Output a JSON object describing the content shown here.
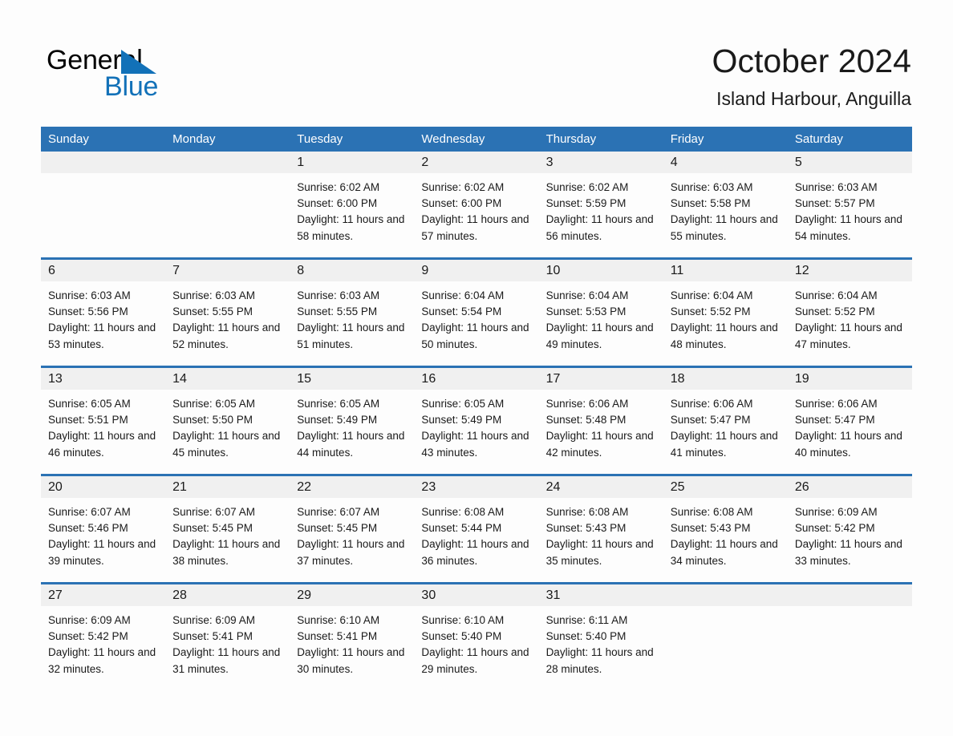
{
  "logo": {
    "word_one": "General",
    "word_two": "Blue",
    "triangle_icon": "triangle-icon",
    "primary_color": "#1271b8"
  },
  "header": {
    "title": "October 2024",
    "location": "Island Harbour, Anguilla"
  },
  "theme": {
    "header_blue": "#2b72b4",
    "day_band_gray": "#f0f0f0",
    "page_background": "#fdfdfd",
    "text_color": "#1a1a1a"
  },
  "calendar": {
    "weekdays": [
      "Sunday",
      "Monday",
      "Tuesday",
      "Wednesday",
      "Thursday",
      "Friday",
      "Saturday"
    ],
    "weeks": [
      [
        {
          "day": "",
          "empty": true
        },
        {
          "day": "",
          "empty": true
        },
        {
          "day": "1",
          "sunrise": "Sunrise: 6:02 AM",
          "sunset": "Sunset: 6:00 PM",
          "daylight": "Daylight: 11 hours and 58 minutes."
        },
        {
          "day": "2",
          "sunrise": "Sunrise: 6:02 AM",
          "sunset": "Sunset: 6:00 PM",
          "daylight": "Daylight: 11 hours and 57 minutes."
        },
        {
          "day": "3",
          "sunrise": "Sunrise: 6:02 AM",
          "sunset": "Sunset: 5:59 PM",
          "daylight": "Daylight: 11 hours and 56 minutes."
        },
        {
          "day": "4",
          "sunrise": "Sunrise: 6:03 AM",
          "sunset": "Sunset: 5:58 PM",
          "daylight": "Daylight: 11 hours and 55 minutes."
        },
        {
          "day": "5",
          "sunrise": "Sunrise: 6:03 AM",
          "sunset": "Sunset: 5:57 PM",
          "daylight": "Daylight: 11 hours and 54 minutes."
        }
      ],
      [
        {
          "day": "6",
          "sunrise": "Sunrise: 6:03 AM",
          "sunset": "Sunset: 5:56 PM",
          "daylight": "Daylight: 11 hours and 53 minutes."
        },
        {
          "day": "7",
          "sunrise": "Sunrise: 6:03 AM",
          "sunset": "Sunset: 5:55 PM",
          "daylight": "Daylight: 11 hours and 52 minutes."
        },
        {
          "day": "8",
          "sunrise": "Sunrise: 6:03 AM",
          "sunset": "Sunset: 5:55 PM",
          "daylight": "Daylight: 11 hours and 51 minutes."
        },
        {
          "day": "9",
          "sunrise": "Sunrise: 6:04 AM",
          "sunset": "Sunset: 5:54 PM",
          "daylight": "Daylight: 11 hours and 50 minutes."
        },
        {
          "day": "10",
          "sunrise": "Sunrise: 6:04 AM",
          "sunset": "Sunset: 5:53 PM",
          "daylight": "Daylight: 11 hours and 49 minutes."
        },
        {
          "day": "11",
          "sunrise": "Sunrise: 6:04 AM",
          "sunset": "Sunset: 5:52 PM",
          "daylight": "Daylight: 11 hours and 48 minutes."
        },
        {
          "day": "12",
          "sunrise": "Sunrise: 6:04 AM",
          "sunset": "Sunset: 5:52 PM",
          "daylight": "Daylight: 11 hours and 47 minutes."
        }
      ],
      [
        {
          "day": "13",
          "sunrise": "Sunrise: 6:05 AM",
          "sunset": "Sunset: 5:51 PM",
          "daylight": "Daylight: 11 hours and 46 minutes."
        },
        {
          "day": "14",
          "sunrise": "Sunrise: 6:05 AM",
          "sunset": "Sunset: 5:50 PM",
          "daylight": "Daylight: 11 hours and 45 minutes."
        },
        {
          "day": "15",
          "sunrise": "Sunrise: 6:05 AM",
          "sunset": "Sunset: 5:49 PM",
          "daylight": "Daylight: 11 hours and 44 minutes."
        },
        {
          "day": "16",
          "sunrise": "Sunrise: 6:05 AM",
          "sunset": "Sunset: 5:49 PM",
          "daylight": "Daylight: 11 hours and 43 minutes."
        },
        {
          "day": "17",
          "sunrise": "Sunrise: 6:06 AM",
          "sunset": "Sunset: 5:48 PM",
          "daylight": "Daylight: 11 hours and 42 minutes."
        },
        {
          "day": "18",
          "sunrise": "Sunrise: 6:06 AM",
          "sunset": "Sunset: 5:47 PM",
          "daylight": "Daylight: 11 hours and 41 minutes."
        },
        {
          "day": "19",
          "sunrise": "Sunrise: 6:06 AM",
          "sunset": "Sunset: 5:47 PM",
          "daylight": "Daylight: 11 hours and 40 minutes."
        }
      ],
      [
        {
          "day": "20",
          "sunrise": "Sunrise: 6:07 AM",
          "sunset": "Sunset: 5:46 PM",
          "daylight": "Daylight: 11 hours and 39 minutes."
        },
        {
          "day": "21",
          "sunrise": "Sunrise: 6:07 AM",
          "sunset": "Sunset: 5:45 PM",
          "daylight": "Daylight: 11 hours and 38 minutes."
        },
        {
          "day": "22",
          "sunrise": "Sunrise: 6:07 AM",
          "sunset": "Sunset: 5:45 PM",
          "daylight": "Daylight: 11 hours and 37 minutes."
        },
        {
          "day": "23",
          "sunrise": "Sunrise: 6:08 AM",
          "sunset": "Sunset: 5:44 PM",
          "daylight": "Daylight: 11 hours and 36 minutes."
        },
        {
          "day": "24",
          "sunrise": "Sunrise: 6:08 AM",
          "sunset": "Sunset: 5:43 PM",
          "daylight": "Daylight: 11 hours and 35 minutes."
        },
        {
          "day": "25",
          "sunrise": "Sunrise: 6:08 AM",
          "sunset": "Sunset: 5:43 PM",
          "daylight": "Daylight: 11 hours and 34 minutes."
        },
        {
          "day": "26",
          "sunrise": "Sunrise: 6:09 AM",
          "sunset": "Sunset: 5:42 PM",
          "daylight": "Daylight: 11 hours and 33 minutes."
        }
      ],
      [
        {
          "day": "27",
          "sunrise": "Sunrise: 6:09 AM",
          "sunset": "Sunset: 5:42 PM",
          "daylight": "Daylight: 11 hours and 32 minutes."
        },
        {
          "day": "28",
          "sunrise": "Sunrise: 6:09 AM",
          "sunset": "Sunset: 5:41 PM",
          "daylight": "Daylight: 11 hours and 31 minutes."
        },
        {
          "day": "29",
          "sunrise": "Sunrise: 6:10 AM",
          "sunset": "Sunset: 5:41 PM",
          "daylight": "Daylight: 11 hours and 30 minutes."
        },
        {
          "day": "30",
          "sunrise": "Sunrise: 6:10 AM",
          "sunset": "Sunset: 5:40 PM",
          "daylight": "Daylight: 11 hours and 29 minutes."
        },
        {
          "day": "31",
          "sunrise": "Sunrise: 6:11 AM",
          "sunset": "Sunset: 5:40 PM",
          "daylight": "Daylight: 11 hours and 28 minutes."
        },
        {
          "day": "",
          "empty": true
        },
        {
          "day": "",
          "empty": true
        }
      ]
    ]
  }
}
